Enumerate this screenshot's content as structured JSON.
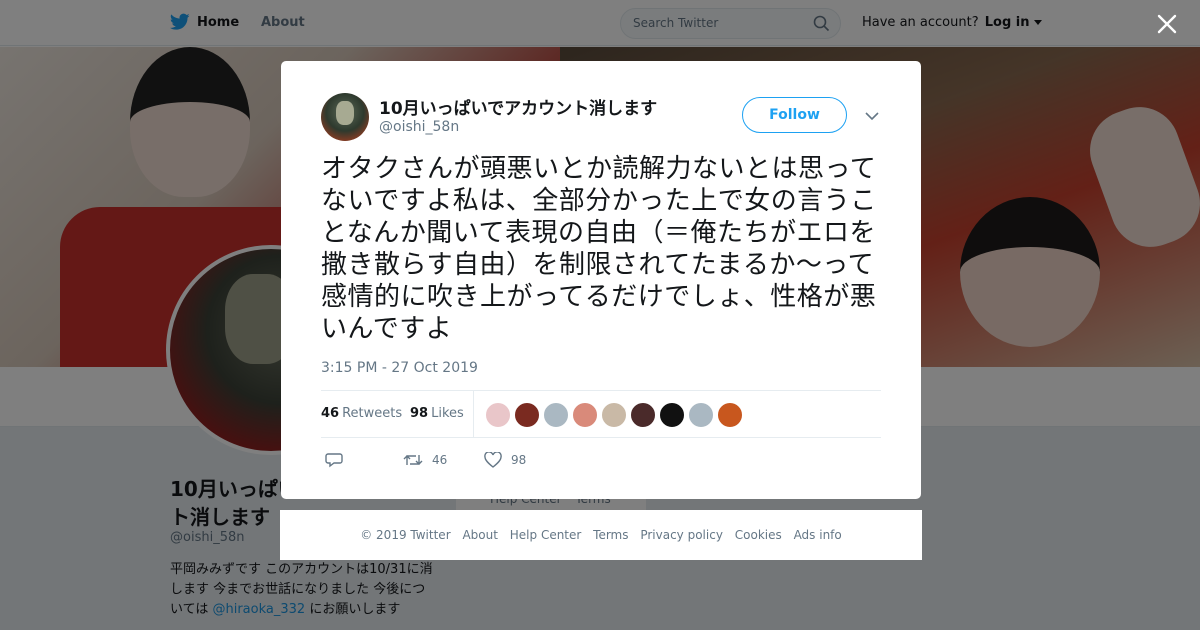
{
  "topbar": {
    "home_label": "Home",
    "about_label": "About",
    "search_placeholder": "Search Twitter",
    "have_account_label": "Have an account?",
    "login_label": "Log in"
  },
  "profile": {
    "name": "10月いっぱいでアカウン\nト消します",
    "handle": "@oishi_58n",
    "bio_text": "平岡みみずです このアカウントは10/31に消します 今までお世話になりました 今後については ",
    "bio_link": "@hiraoka_332",
    "bio_suffix": " にお願いします",
    "help_peek": [
      "Help Center",
      "Terms"
    ]
  },
  "tweet": {
    "author_name": "10月いっぱいでアカウント消します",
    "author_handle": "@oishi_58n",
    "follow_label": "Follow",
    "text": "オタクさんが頭悪いとか読解力ないとは思ってないですよ私は、全部分かった上で女の言うことなんか聞いて表現の自由（＝俺たちがエロを撒き散らす自由）を制限されてたまるか〜って感情的に吹き上がってるだけでしょ、性格が悪いんですよ",
    "timestamp": "3:15 PM - 27 Oct 2019",
    "retweets_count": "46",
    "retweets_label": "Retweets",
    "likes_count": "98",
    "likes_label": "Likes",
    "action_retweet_count": "46",
    "action_like_count": "98",
    "liker_colors": [
      "#e9c6c9",
      "#7a2a20",
      "#aab8c2",
      "#d98a7a",
      "#c9b9a6",
      "#4a2a2a",
      "#111111",
      "#aab8c2",
      "#c8571e"
    ]
  },
  "footer": {
    "copyright": "© 2019 Twitter",
    "about": "About",
    "help_center": "Help Center",
    "terms": "Terms",
    "privacy": "Privacy policy",
    "cookies": "Cookies",
    "ads_info": "Ads info"
  },
  "colors": {
    "accent": "#1da1f2",
    "text": "#14171a",
    "secondary": "#657786"
  }
}
